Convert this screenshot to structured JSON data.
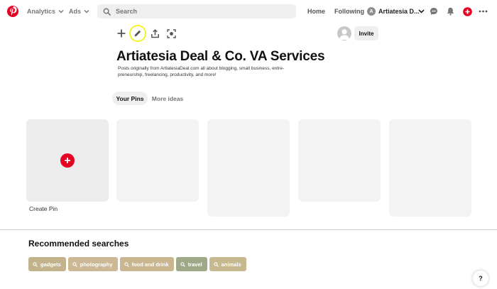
{
  "header": {
    "nav": [
      {
        "label": "Analytics"
      },
      {
        "label": "Ads"
      }
    ],
    "search": {
      "placeholder": "Search"
    },
    "links": [
      {
        "label": "Home"
      },
      {
        "label": "Following"
      }
    ],
    "profile": {
      "initial": "A",
      "name": "Artiatesia D..."
    },
    "brand_color": "#e60023"
  },
  "board": {
    "title": "Artiatesia Deal & Co. VA Services",
    "description": "Posts originally from ArtiatesiaDeal.com all about blogging, small business, entre-preneurship, freelancing, productivity, and more!",
    "invite_label": "Invite",
    "actions": [
      "plus-icon",
      "pencil-icon",
      "share-icon",
      "organize-icon"
    ],
    "tabs": [
      {
        "label": "Your Pins",
        "active": true
      },
      {
        "label": "More ideas",
        "active": false
      }
    ],
    "create_pin_label": "Create Pin",
    "placeholder_pin_count": 4
  },
  "recommended": {
    "title": "Recommended searches",
    "chips": [
      {
        "label": "gadgets",
        "color": "#c2b38d"
      },
      {
        "label": "photography",
        "color": "#cbb996"
      },
      {
        "label": "food and drink",
        "color": "#c9b58f"
      },
      {
        "label": "travel",
        "color": "#a0a88a"
      },
      {
        "label": "animals",
        "color": "#c6b88f"
      }
    ]
  },
  "help": {
    "label": "?"
  }
}
